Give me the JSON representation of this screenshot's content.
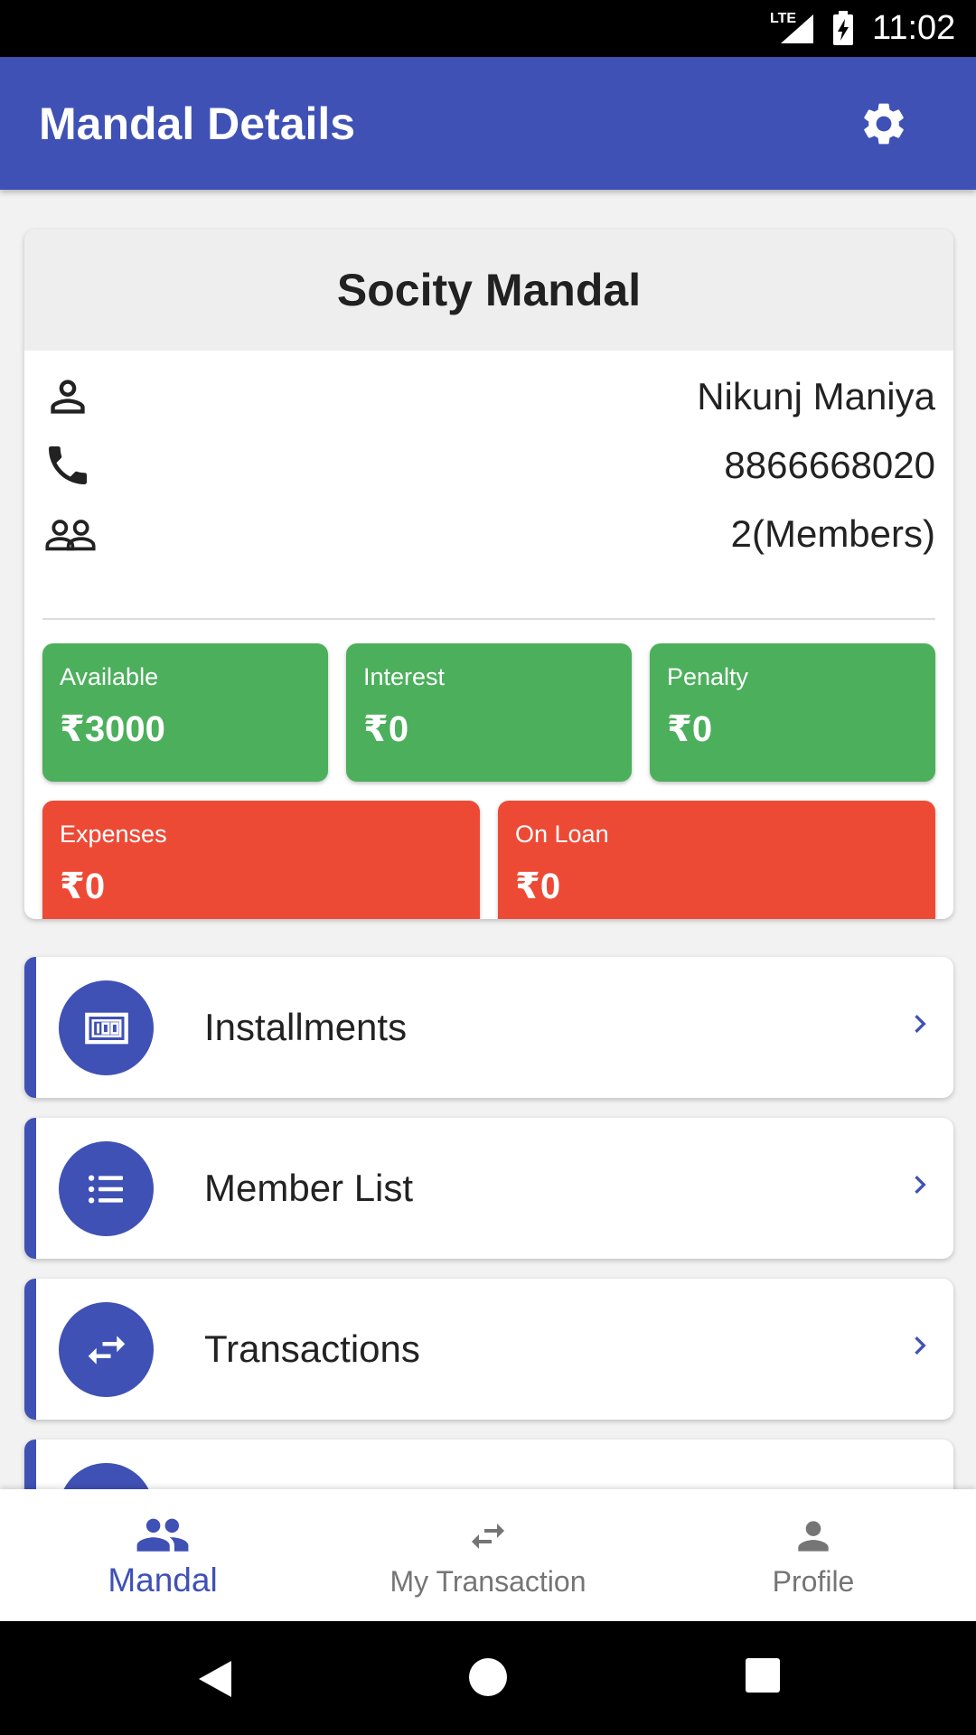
{
  "status_bar": {
    "network": "LTE",
    "time": "11:02"
  },
  "app_bar": {
    "title": "Mandal Details",
    "settings_icon": "gear-icon"
  },
  "mandal_card": {
    "name": "Socity Mandal",
    "info": {
      "owner": "Nikunj Maniya",
      "phone": "8866668020",
      "members": "2(Members)"
    },
    "stats": [
      {
        "label": "Available",
        "amount": "₹3000",
        "color": "#4caf5c"
      },
      {
        "label": "Interest",
        "amount": "₹0",
        "color": "#4caf5c"
      },
      {
        "label": "Penalty",
        "amount": "₹0",
        "color": "#4caf5c"
      },
      {
        "label": "Expenses",
        "amount": "₹0",
        "color": "#ed4a36"
      },
      {
        "label": "On Loan",
        "amount": "₹0",
        "color": "#ed4a36"
      }
    ]
  },
  "menu": [
    {
      "label": "Installments",
      "icon": "money-icon"
    },
    {
      "label": "Member List",
      "icon": "list-icon"
    },
    {
      "label": "Transactions",
      "icon": "swap-arrows-icon"
    },
    {
      "label": "",
      "icon": "calculator-icon"
    }
  ],
  "bottom_nav": {
    "items": [
      {
        "label": "Mandal",
        "icon": "group-icon",
        "active": true
      },
      {
        "label": "My Transaction",
        "icon": "swap-arrows-icon",
        "active": false
      },
      {
        "label": "Profile",
        "icon": "person-icon",
        "active": false
      }
    ]
  },
  "colors": {
    "primary": "#3f51b5",
    "positive": "#4caf5c",
    "negative": "#ed4a36"
  }
}
